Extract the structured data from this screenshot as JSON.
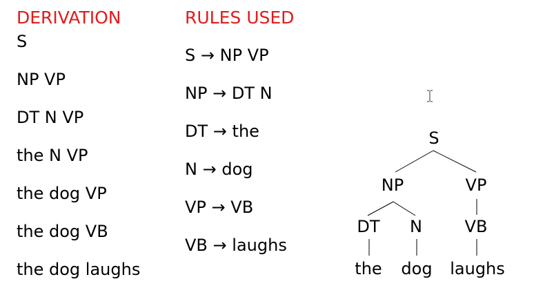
{
  "colors": {
    "heading": "#e21b1b",
    "text": "#000000",
    "background": "#ffffff"
  },
  "derivation": {
    "heading": "DERIVATION",
    "steps": [
      "S",
      "NP VP",
      "DT N VP",
      "the N VP",
      "the dog VP",
      "the dog VB",
      "the dog laughs"
    ]
  },
  "rules": {
    "heading": "RULES USED",
    "arrow": "→",
    "items": [
      {
        "lhs": "S",
        "rhs": "NP VP"
      },
      {
        "lhs": "NP",
        "rhs": "DT N"
      },
      {
        "lhs": "DT",
        "rhs": "the"
      },
      {
        "lhs": "N",
        "rhs": "dog"
      },
      {
        "lhs": "VP",
        "rhs": "VB"
      },
      {
        "lhs": "VB",
        "rhs": "laughs"
      }
    ]
  },
  "tree": {
    "nodes": {
      "s": "S",
      "np": "NP",
      "vp": "VP",
      "dt": "DT",
      "n": "N",
      "vb": "VB",
      "the": "the",
      "dog": "dog",
      "laughs": "laughs"
    }
  },
  "cursor_icon": "text-cursor-icon"
}
